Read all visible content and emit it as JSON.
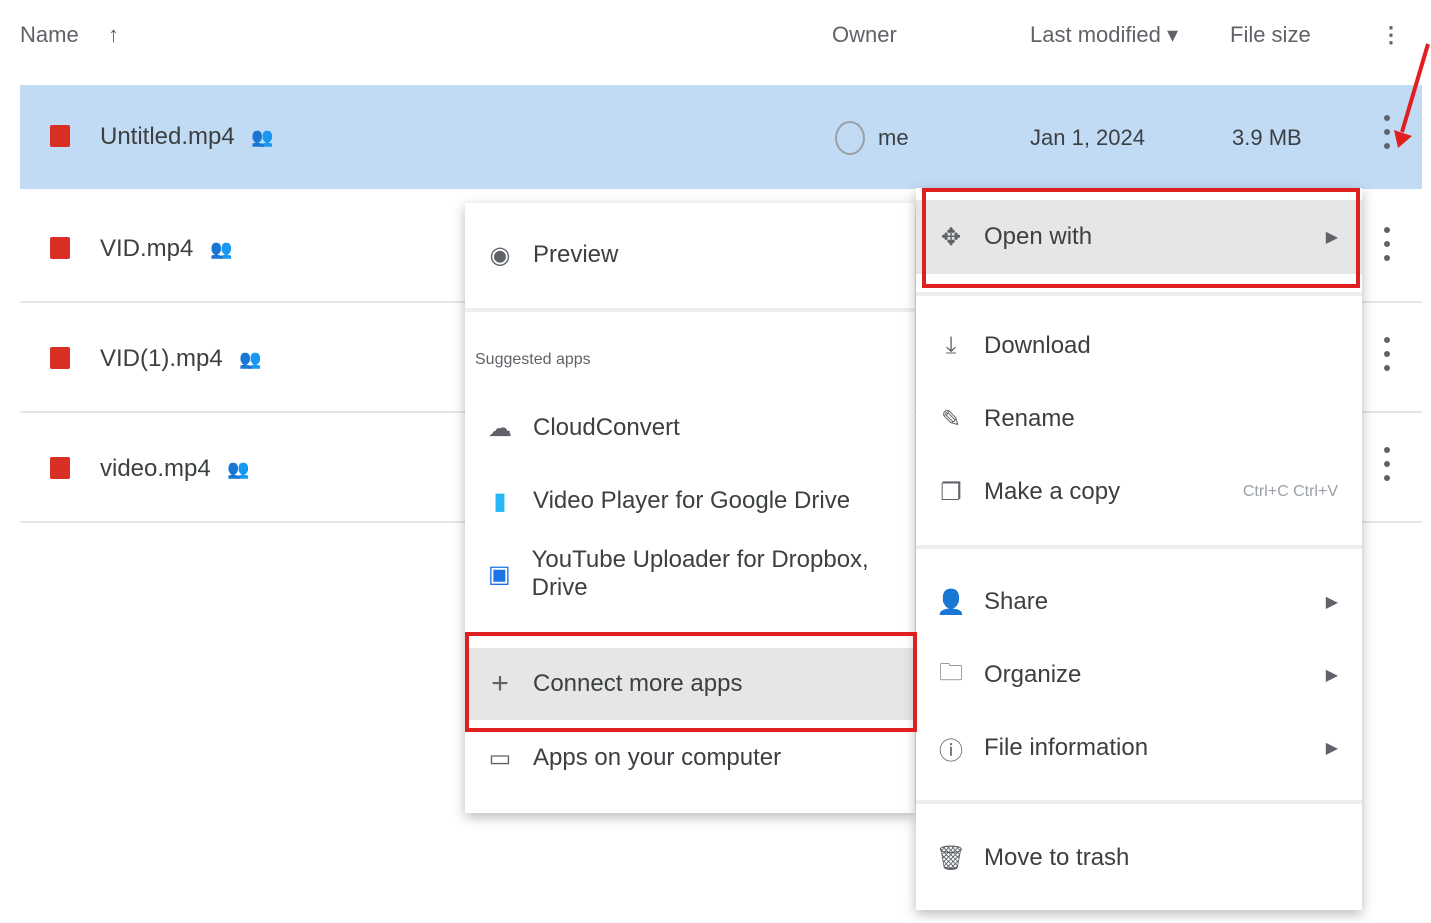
{
  "header": {
    "name": "Name",
    "sort_arrow": "↑",
    "owner": "Owner",
    "last_modified": "Last modified ▾",
    "file_size": "File size",
    "more": "⋮"
  },
  "files": [
    {
      "name": "Untitled.mp4",
      "owner": "me",
      "modified": "Jan 1, 2024",
      "size": "3.9 MB"
    },
    {
      "name": "VID.mp4"
    },
    {
      "name": "VID(1).mp4"
    },
    {
      "name": "video.mp4"
    }
  ],
  "open_with_menu": {
    "preview": "Preview",
    "section_label": "Suggested apps",
    "apps": [
      "CloudConvert",
      "Video Player for Google Drive",
      "YouTube Uploader for Dropbox, Drive"
    ],
    "connect": "Connect more apps",
    "computer": "Apps on your computer"
  },
  "context_menu": {
    "open_with": "Open with",
    "download": "Download",
    "rename": "Rename",
    "copy": "Make a copy",
    "copy_shortcut": "Ctrl+C Ctrl+V",
    "share": "Share",
    "organize": "Organize",
    "info": "File information",
    "trash": "Move to trash"
  },
  "icons": {
    "file": "video-file-icon",
    "shared": "people-icon",
    "preview": "eye-icon",
    "open_with": "move-arrows-icon",
    "download": "download-icon",
    "rename": "pencil-icon",
    "copy": "copy-icon",
    "share": "person-add-icon",
    "organize": "folder-icon",
    "info": "info-icon",
    "trash": "trash-icon",
    "plus": "plus-icon",
    "laptop": "laptop-icon"
  },
  "colors": {
    "selected_row": "#c2dbf5",
    "highlight": "#e02020",
    "file_red": "#d93025"
  }
}
